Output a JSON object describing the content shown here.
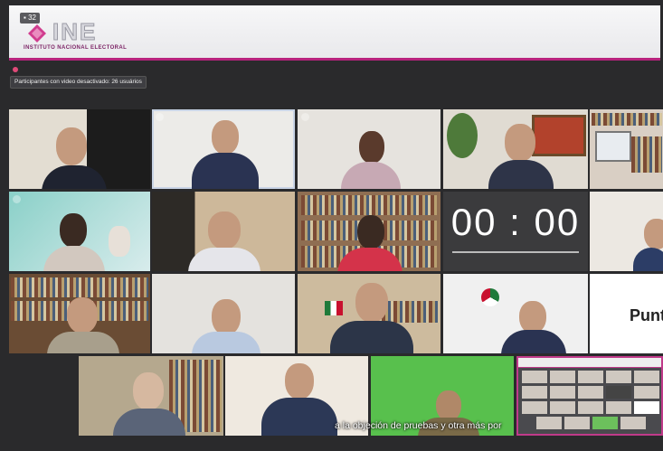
{
  "header": {
    "badge": "32",
    "logo_text": "INE",
    "logo_subtitle": "INSTITUTO NACIONAL ELECTORAL"
  },
  "notice": "Participantes con video desactivado: 26 usuários",
  "timer": "00 : 00",
  "partial_text": "Punt",
  "subtitle": "a la objeción de pruebas y otra más por",
  "colors": {
    "brand": "#b8237d",
    "background": "#2a2a2c"
  },
  "tiles": [
    "participant-1",
    "participant-2",
    "participant-3",
    "participant-4",
    "participant-5",
    "participant-6",
    "participant-7",
    "participant-8",
    "timer",
    "participant-9",
    "participant-10",
    "participant-11",
    "participant-12",
    "participant-13",
    "slide",
    "participant-14",
    "participant-15",
    "participant-16",
    "gallery-thumbnail"
  ]
}
